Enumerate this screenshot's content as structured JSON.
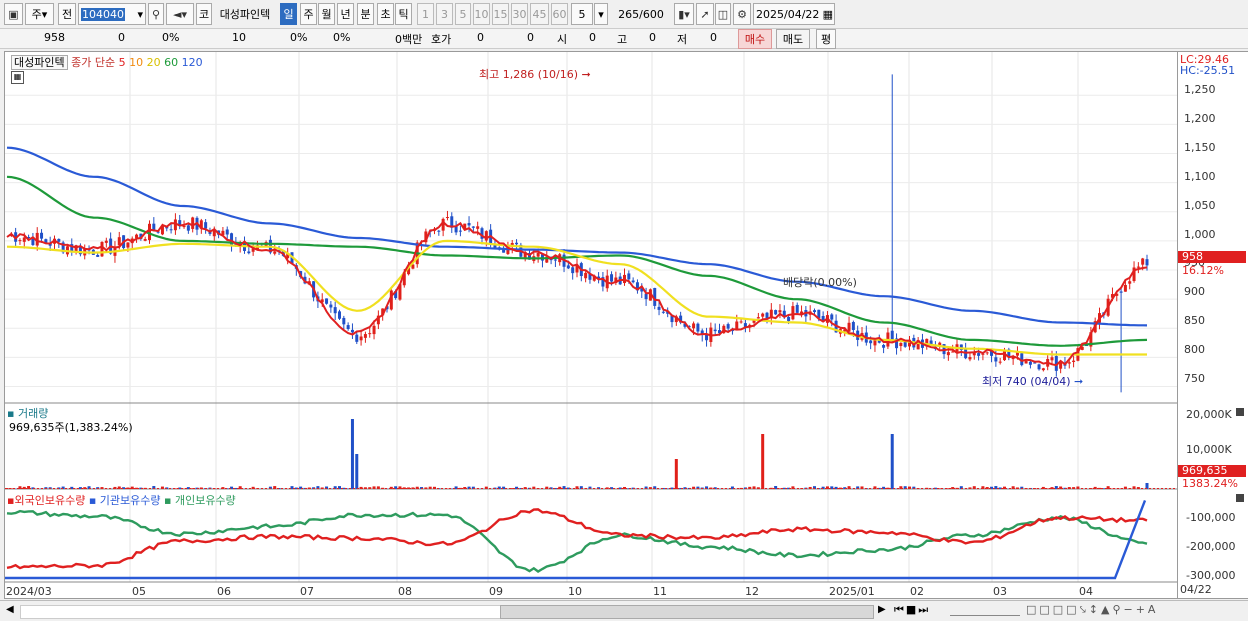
{
  "toolbar": {
    "period": "주",
    "compare": "전",
    "code": "104040",
    "market_badge": "코",
    "stock_name": "대성파인텍",
    "periods": [
      "일",
      "주",
      "월",
      "년",
      "분",
      "초",
      "틱"
    ],
    "active_period": "일",
    "intervals": [
      "1",
      "3",
      "5",
      "10",
      "15",
      "30",
      "45",
      "60"
    ],
    "interval_value": "5",
    "count": "265",
    "count_total": "/600",
    "date": "2025/04/22"
  },
  "quote": {
    "price": "958",
    "change": "0",
    "change_pct": "0%",
    "volume": "10",
    "pct2": "0%",
    "pct3": "0%",
    "amount": "0백만",
    "hoga_label": "호가",
    "hoga1": "0",
    "hoga2": "0",
    "si_label": "시",
    "si": "0",
    "go_label": "고",
    "go": "0",
    "jeo_label": "저",
    "jeo": "0",
    "buy": "매수",
    "sell": "매도",
    "avg": "평"
  },
  "legend": {
    "name": "대성파인텍",
    "ma_label": "종가 단순",
    "ma5": "5",
    "ma10": "10",
    "ma20": "20",
    "ma60": "60",
    "ma120": "120",
    "lc": "LC:29.46",
    "hc": "HC:-25.51"
  },
  "annotations": {
    "high": "최고 1,286 (10/16)",
    "low": "최저 740 (04/04)",
    "dividend": "배당락(0.00%)"
  },
  "price_axis": {
    "ticks": [
      "1,250",
      "1,200",
      "1,150",
      "1,100",
      "1,050",
      "1,000",
      "950",
      "900",
      "850",
      "800",
      "750"
    ],
    "current": "958",
    "current_pct": "16.12%"
  },
  "volume_panel": {
    "title": "거래량",
    "value": "969,635주(1,383.24%)",
    "ticks": [
      "20,000K",
      "10,000K"
    ],
    "current": "969,635",
    "current_pct": "1383.24%"
  },
  "holding_panel": {
    "foreign": "외국인보유수량",
    "inst": "기관보유수량",
    "indiv": "개인보유수량",
    "ticks": [
      "-100,000",
      "-200,000",
      "-300,000"
    ]
  },
  "x_axis": [
    "2024/03",
    "05",
    "06",
    "07",
    "08",
    "09",
    "10",
    "11",
    "12",
    "2025/01",
    "02",
    "03",
    "04",
    "04/22"
  ],
  "colors": {
    "up": "#e0201a",
    "down": "#2050c8",
    "ma5": "#e02020",
    "ma10": "#f08a10",
    "ma20": "#f0e020",
    "ma60": "#1e9a3a",
    "ma120": "#2a5ad6",
    "accent": "#2d6cc0",
    "foreign": "#e02020",
    "indiv": "#2e9b5e",
    "inst": "#2a5ad6"
  },
  "chart_data": {
    "type": "line",
    "title": "대성파인텍",
    "ylim": [
      720,
      1290
    ],
    "x": [
      "2024/03",
      "05",
      "06",
      "07",
      "08",
      "09",
      "10",
      "11",
      "12",
      "2025/01",
      "02",
      "03",
      "04",
      "04/22"
    ],
    "series": [
      {
        "name": "120",
        "values": [
          1160,
          1110,
          1060,
          1030,
          1005,
          990,
          985,
          980,
          960,
          930,
          905,
          880,
          860,
          855
        ]
      },
      {
        "name": "60",
        "values": [
          1110,
          1040,
          1000,
          995,
          990,
          975,
          970,
          975,
          940,
          900,
          860,
          830,
          820,
          830
        ]
      },
      {
        "name": "20",
        "values": [
          990,
          980,
          995,
          990,
          880,
          1000,
          990,
          960,
          870,
          860,
          830,
          815,
          805,
          805
        ]
      },
      {
        "name": "5",
        "values": [
          1010,
          985,
          1030,
          985,
          840,
          1030,
          980,
          930,
          840,
          875,
          830,
          810,
          790,
          958
        ]
      }
    ],
    "markers": {
      "high": 1286,
      "low": 740,
      "current": 958
    }
  }
}
